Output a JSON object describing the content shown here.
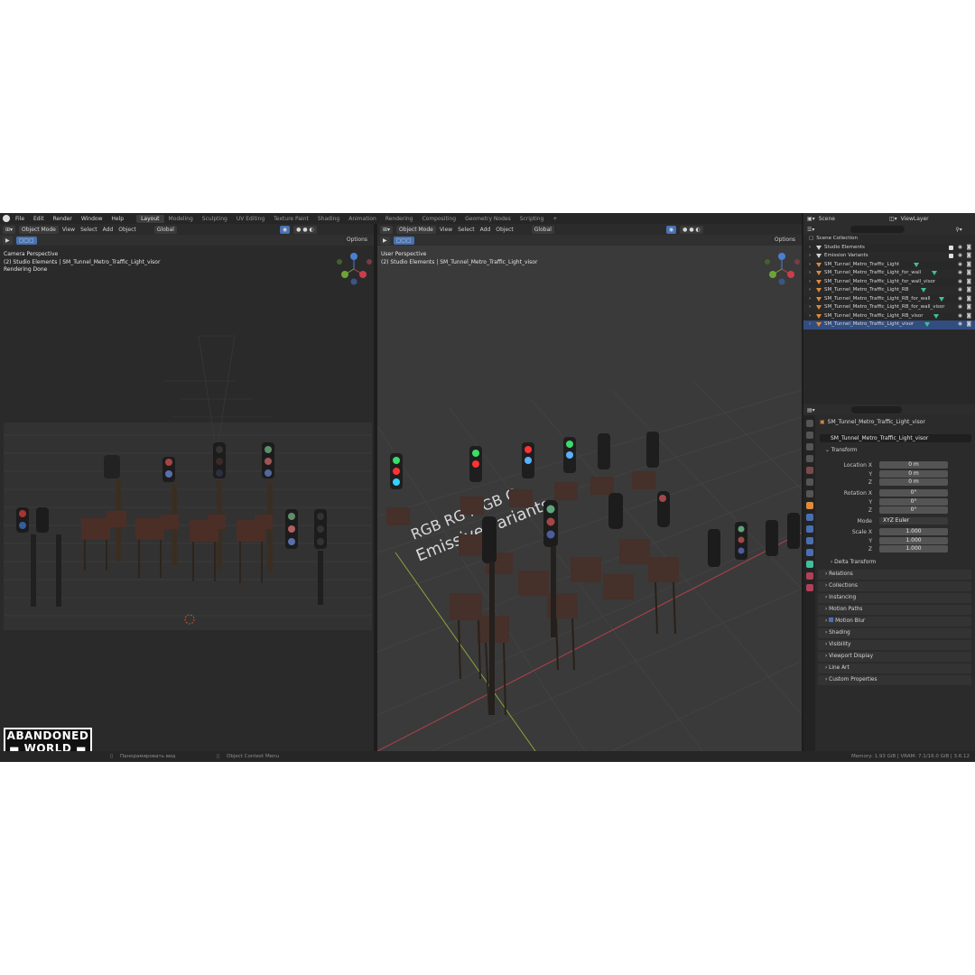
{
  "topbar": {
    "menu": [
      "File",
      "Edit",
      "Render",
      "Window",
      "Help"
    ],
    "workspaces": [
      "Layout",
      "Modeling",
      "Sculpting",
      "UV Editing",
      "Texture Paint",
      "Shading",
      "Animation",
      "Rendering",
      "Compositing",
      "Geometry Nodes",
      "Scripting",
      "+"
    ],
    "active_workspace": "Layout",
    "scene": "Scene",
    "view_layer": "ViewLayer"
  },
  "left_viewport": {
    "mode": "Object Mode",
    "menu": [
      "View",
      "Select",
      "Add",
      "Object"
    ],
    "transform": "Global",
    "options": "Options",
    "overlay_line1": "Camera Perspective",
    "overlay_line2": "(2) Studio Elements | SM_Tunnel_Metro_Traffic_Light_visor",
    "overlay_line3": "Rendering Done"
  },
  "right_viewport": {
    "mode": "Object Mode",
    "menu": [
      "View",
      "Select",
      "Add",
      "Object"
    ],
    "transform": "Global",
    "options": "Options",
    "overlay_line1": "User Perspective",
    "overlay_line2": "(2) Studio Elements | SM_Tunnel_Metro_Traffic_Light_visor",
    "floor_text_1": "RGB  RG   R   GB   G",
    "floor_text_2": "Emissive variants"
  },
  "outliner": {
    "root": "Scene Collection",
    "items": [
      "Studio Elements",
      "Emission Variants",
      "SM_Tunnel_Metro_Traffic_Light",
      "SM_Tunnel_Metro_Traffic_Light_for_wall",
      "SM_Tunnel_Metro_Traffic_Light_for_wall_visor",
      "SM_Tunnel_Metro_Traffic_Light_RB",
      "SM_Tunnel_Metro_Traffic_Light_RB_for_wall",
      "SM_Tunnel_Metro_Traffic_Light_RB_for_wall_visor",
      "SM_Tunnel_Metro_Traffic_Light_RB_visor",
      "SM_Tunnel_Metro_Traffic_Light_visor"
    ]
  },
  "properties": {
    "object_name": "SM_Tunnel_Metro_Traffic_Light_visor",
    "object_name_field": "SM_Tunnel_Metro_Traffic_Light_visor",
    "transform_label": "Transform",
    "location_x_label": "Location X",
    "location_x": "0 m",
    "location_y_label": "Y",
    "location_y": "0 m",
    "location_z_label": "Z",
    "location_z": "0 m",
    "rotation_x_label": "Rotation X",
    "rotation_x": "0°",
    "rotation_y_label": "Y",
    "rotation_y": "0°",
    "rotation_z_label": "Z",
    "rotation_z": "0°",
    "mode_label": "Mode",
    "mode": "XYZ Euler",
    "scale_x_label": "Scale X",
    "scale_x": "1.000",
    "scale_y_label": "Y",
    "scale_y": "1.000",
    "scale_z_label": "Z",
    "scale_z": "1.000",
    "delta_transform": "Delta Transform",
    "sections": [
      "Relations",
      "Collections",
      "Instancing",
      "Motion Paths",
      "Motion Blur",
      "Shading",
      "Visibility",
      "Viewport Display",
      "Line Art",
      "Custom Properties"
    ]
  },
  "statusbar": {
    "hint_pan": "Панорамировать вид",
    "hint_menu": "Object Context Menu",
    "memory": "Memory: 1.93 GiB | VRAM: 7.1/16.0 GiB | 3.6.12"
  },
  "brand": {
    "line1": "ABANDONED",
    "line2": "WORLD"
  }
}
